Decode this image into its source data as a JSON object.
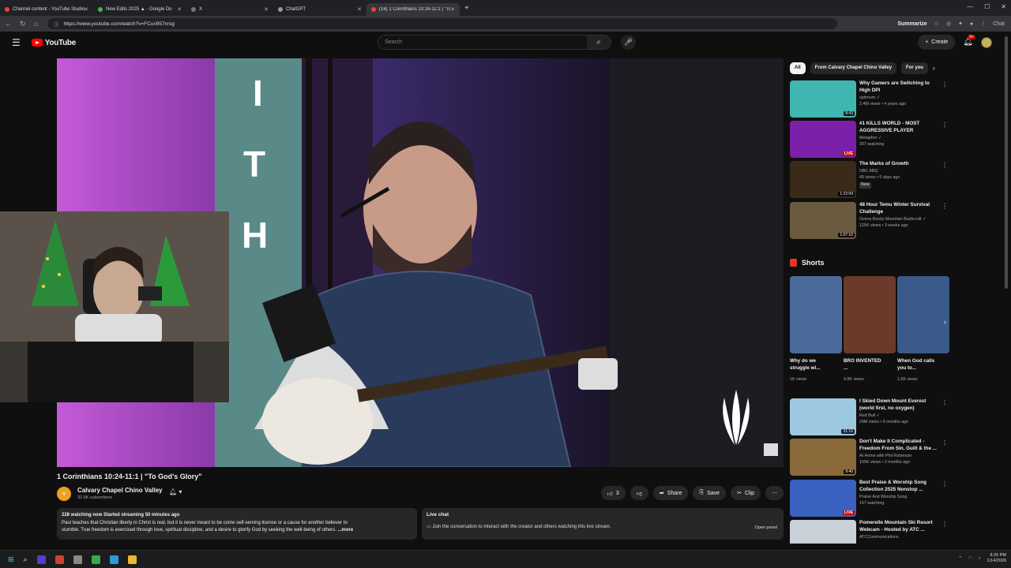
{
  "browser": {
    "tabs": [
      {
        "title": "Channel content - YouTube Studio",
        "color": "#ff3b30"
      },
      {
        "title": "New Edits 2025 ▲ - Google Do",
        "color": "#4caf50"
      },
      {
        "title": "X",
        "color": "#aaaaaa"
      },
      {
        "title": "ChatGPT",
        "color": "#aaaaaa"
      },
      {
        "title": "(16) 1 Corinthians 10:24-11:1 | \"To",
        "color": "#ff3b30"
      }
    ],
    "url": "https://www.youtube.com/watch?v=FCuv957xrsg",
    "summarize_label": "Summarize",
    "chat_label": "Chat"
  },
  "header": {
    "logo_text": "YouTube",
    "search_placeholder": "Search",
    "create_label": "Create",
    "notif_count": "9+"
  },
  "video": {
    "title": "1 Corinthians 10:24-11:1 | \"To God's Glory\"",
    "channel": "Calvary Chapel Chino Valley",
    "subscribers": "32.9K subscribers",
    "like_count": "3",
    "share_label": "Share",
    "save_label": "Save",
    "clip_label": "Clip"
  },
  "description": {
    "meta": "228 watching now  Started streaming 50 minutes ago",
    "line1": "Paul teaches that Christian liberty in Christ is real, but it is never meant to be come self-serving license or a cause for another believer to",
    "line2": "stumble. True freedom is exercised through love, spiritual discipline, and a desire to glorify God by seeking the well-being of others.",
    "more": " ...more"
  },
  "live_chat": {
    "title": "Live chat",
    "notice": "Join the conversation to interact with the creator and others watching this live stream.",
    "open_panel": "Open panel"
  },
  "chips": [
    "All",
    "From Calvary Chapel Chino Valley",
    "For you"
  ],
  "recommended_top": [
    {
      "title": "Why Gamers are Switching to High DPI",
      "channel": "optimum ✓",
      "meta": "2.4M views • 4 years ago",
      "badge": "8:43",
      "color": "#3fb6b0"
    },
    {
      "title": "#1 KILLS WORLD - MOST AGGRESSIVE PLAYER",
      "channel": "Metaphor ✓",
      "meta": "307 watching",
      "badge": "LIVE",
      "color": "#7a1fa8"
    },
    {
      "title": "The Marks of Growth",
      "channel": "NBC ABQ",
      "meta": "49 views • 6 days ago",
      "badge": "1:22:09",
      "extra": "New",
      "color": "#3a2a1a"
    },
    {
      "title": "48 Hour Temu Winter Survival Challenge",
      "channel": "Ovens Rocky Mountain Bushcraft ✓",
      "meta": "125K views • 3 weeks ago",
      "badge": "1:07:10",
      "color": "#6a5a40"
    }
  ],
  "shorts": {
    "heading": "Shorts",
    "items": [
      {
        "title": "Why do we struggle wi...",
        "views": "1K views",
        "color": "#4a6a9a"
      },
      {
        "title": "BRO INVENTED ...",
        "views": "9.8K views",
        "color": "#6a3a2a"
      },
      {
        "title": "When God calls you to...",
        "views": "1.6K views",
        "color": "#3a5a8a"
      }
    ]
  },
  "recommended_bottom": [
    {
      "title": "I Skied Down Mount Everest (world first, no oxygen)",
      "channel": "Red Bull ✓",
      "meta": "29M views • 9 months ago",
      "badge": "31:16",
      "color": "#9cc8e0"
    },
    {
      "title": "Don't Make It Complicated - Freedom From Sin, Guilt & the ...",
      "channel": "At Home with Phil Roberson",
      "meta": "155K views • 2 months ago",
      "badge": "9:40",
      "color": "#8a6a3a"
    },
    {
      "title": "Best Praise & Worship Song Collection 2025 Nonstop ...",
      "channel": "Praise And Worship Song",
      "meta": "167 watching",
      "badge": "LIVE",
      "color": "#3a60c0"
    },
    {
      "title": "Pomerelle Mountain Ski Resort Webcam - Hosted by ATC ...",
      "channel": "ATCCommunications",
      "meta": "",
      "badge": "",
      "color": "#c8d0d8"
    }
  ],
  "taskbar": {
    "time": "8:25 PM",
    "date": "1/14/2026"
  }
}
